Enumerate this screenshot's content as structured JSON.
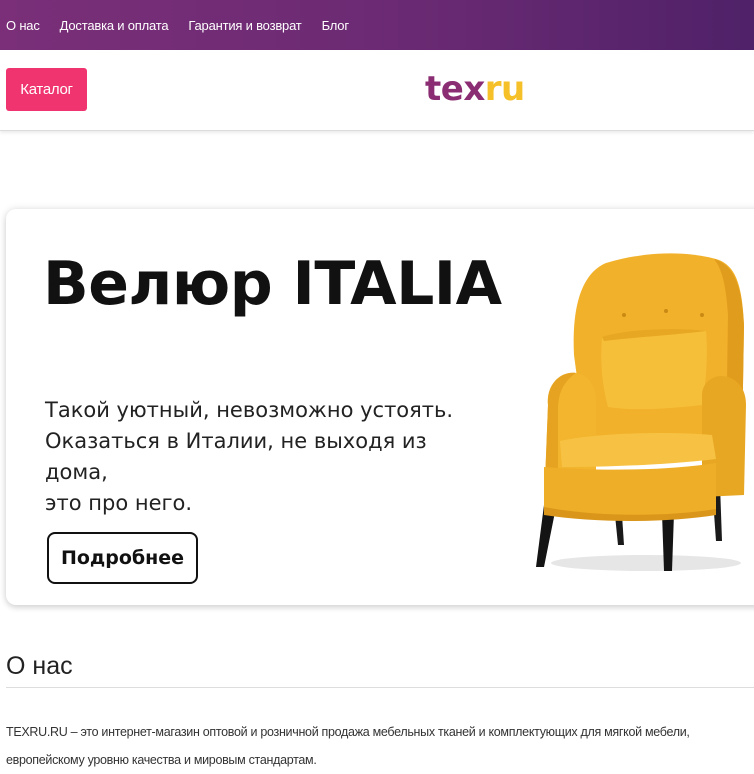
{
  "topnav": {
    "items": [
      {
        "label": "О нас"
      },
      {
        "label": "Доставка и оплата"
      },
      {
        "label": "Гарантия и возврат"
      },
      {
        "label": "Блог"
      }
    ]
  },
  "header": {
    "catalog_label": "Каталог",
    "logo_part1": "tex",
    "logo_part2": "ru"
  },
  "banner": {
    "title": "Велюр ITALIA",
    "text_line1": "Такой уютный, невозможно устоять.",
    "text_line2": "Оказаться в Италии, не выходя из дома,",
    "text_line3": "это про него.",
    "button_label": "Подробнее"
  },
  "about": {
    "title": "О нас",
    "line1": "TEXRU.RU – это интернет-магазин оптовой и розничной продажа мебельных тканей и комплектующих для мягкой мебели,",
    "line2": "европейскому уровню качества и мировым стандартам."
  },
  "colors": {
    "topbar": "#6a2a73",
    "catalog_button": "#f0346f",
    "logo_primary": "#8b2d73",
    "logo_accent": "#f5c028",
    "chair": "#f4b72c"
  },
  "icons": {
    "banner_image": "yellow-armchair"
  }
}
